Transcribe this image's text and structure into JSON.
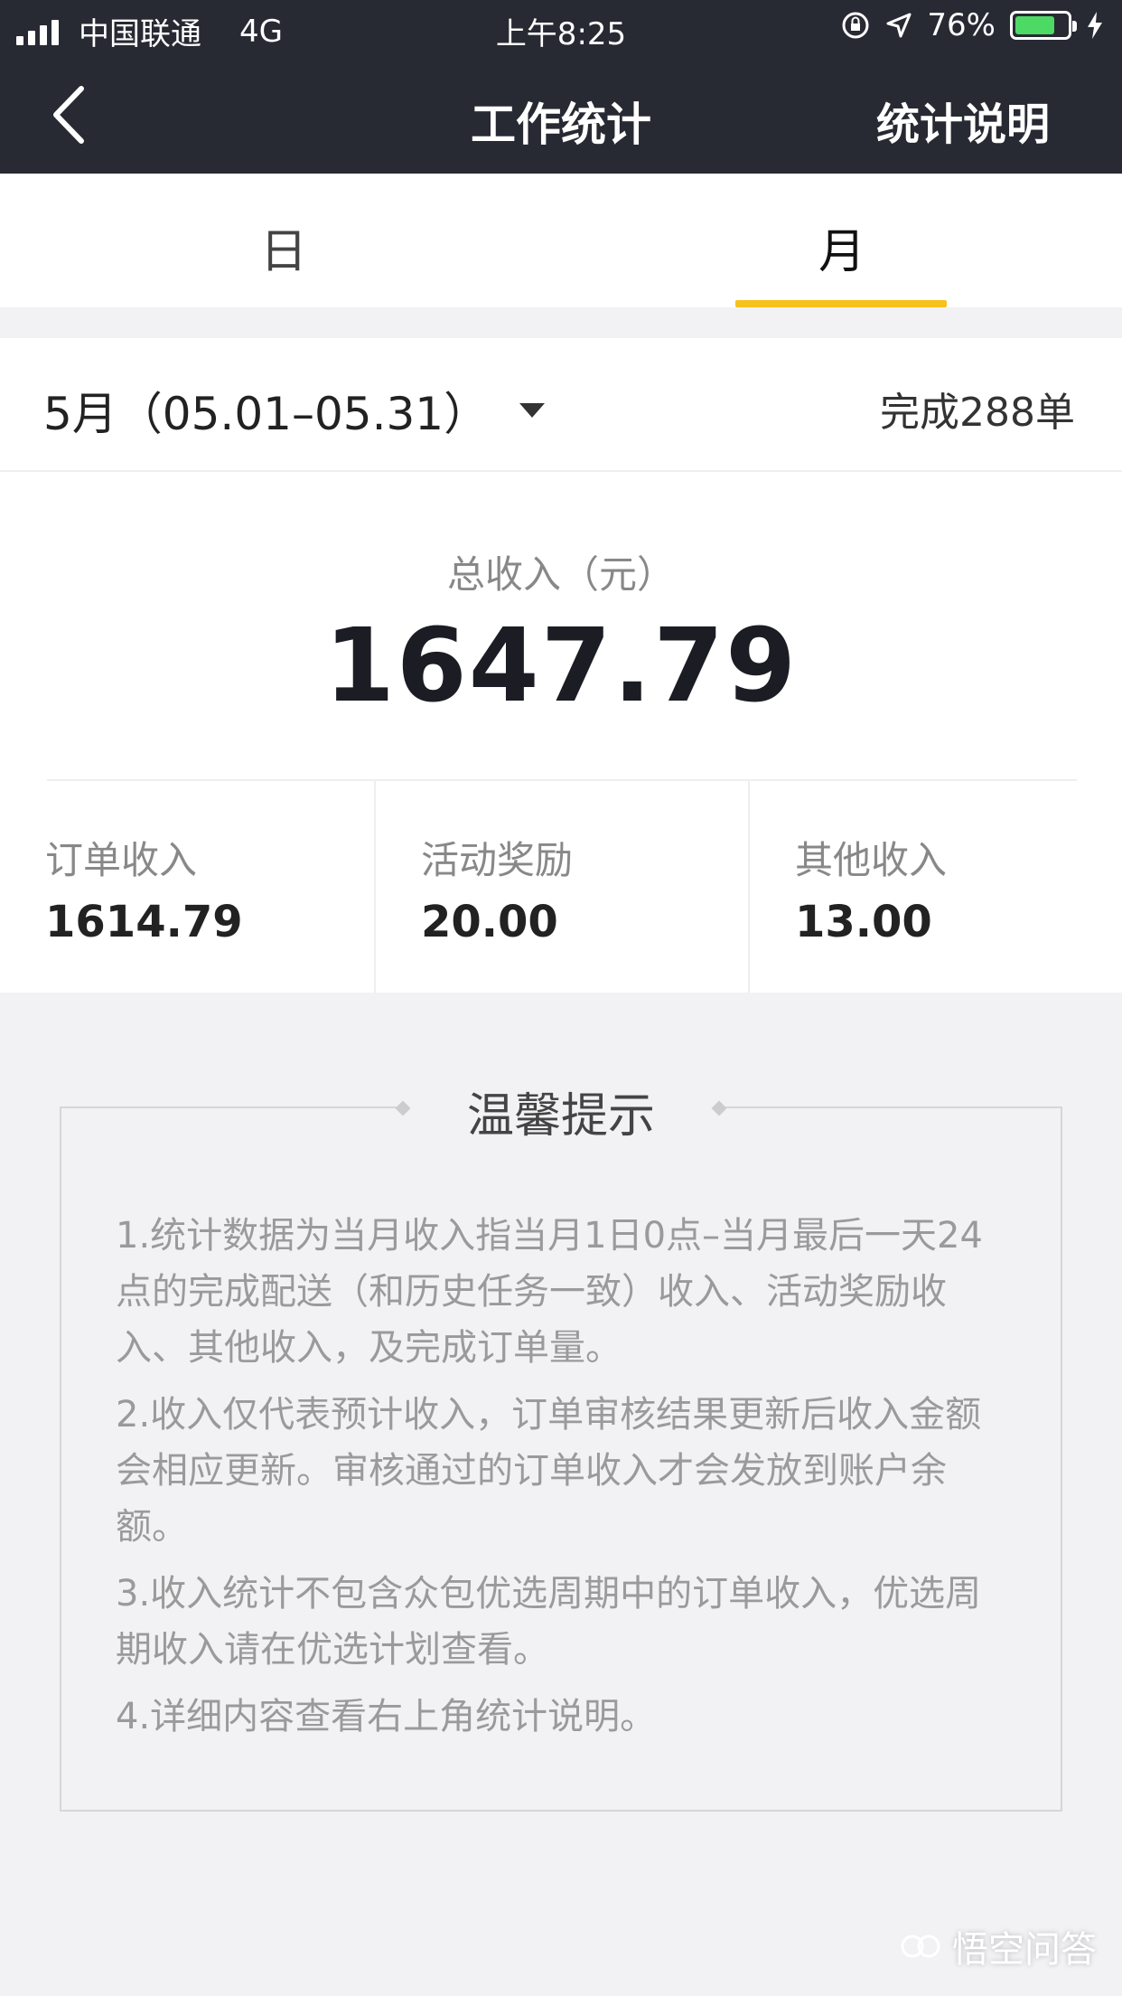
{
  "status_bar": {
    "carrier": "中国联通",
    "network": "4G",
    "time": "上午8:25",
    "battery": "76%",
    "battery_level": 0.76
  },
  "nav": {
    "title": "工作统计",
    "explain_label": "统计说明"
  },
  "tabs": [
    {
      "label": "日",
      "selected": false
    },
    {
      "label": "月",
      "selected": true
    }
  ],
  "period": {
    "label": "5月（05.01–05.31）",
    "completed": "完成288单"
  },
  "income": {
    "total_label": "总收入（元）",
    "total_value": "1647.79",
    "items": [
      {
        "label": "订单收入",
        "value": "1614.79"
      },
      {
        "label": "活动奖励",
        "value": "20.00"
      },
      {
        "label": "其他收入",
        "value": "13.00"
      }
    ]
  },
  "tips": {
    "title": "温馨提示",
    "items": [
      "1.统计数据为当月收入指当月1日0点–当月最后一天24点的完成配送（和历史任务一致）收入、活动奖励收入、其他收入，及完成订单量。",
      "2.收入仅代表预计收入，订单审核结果更新后收入金额会相应更新。审核通过的订单收入才会发放到账户余额。",
      "3.收入统计不包含众包优选周期中的订单收入，优选周期收入请在优选计划查看。",
      "4.详细内容查看右上角统计说明。"
    ]
  },
  "watermark": "悟空问答",
  "colors": {
    "header_bg": "#272a33",
    "accent": "#f7c21b",
    "battery_green": "#4cd964"
  }
}
